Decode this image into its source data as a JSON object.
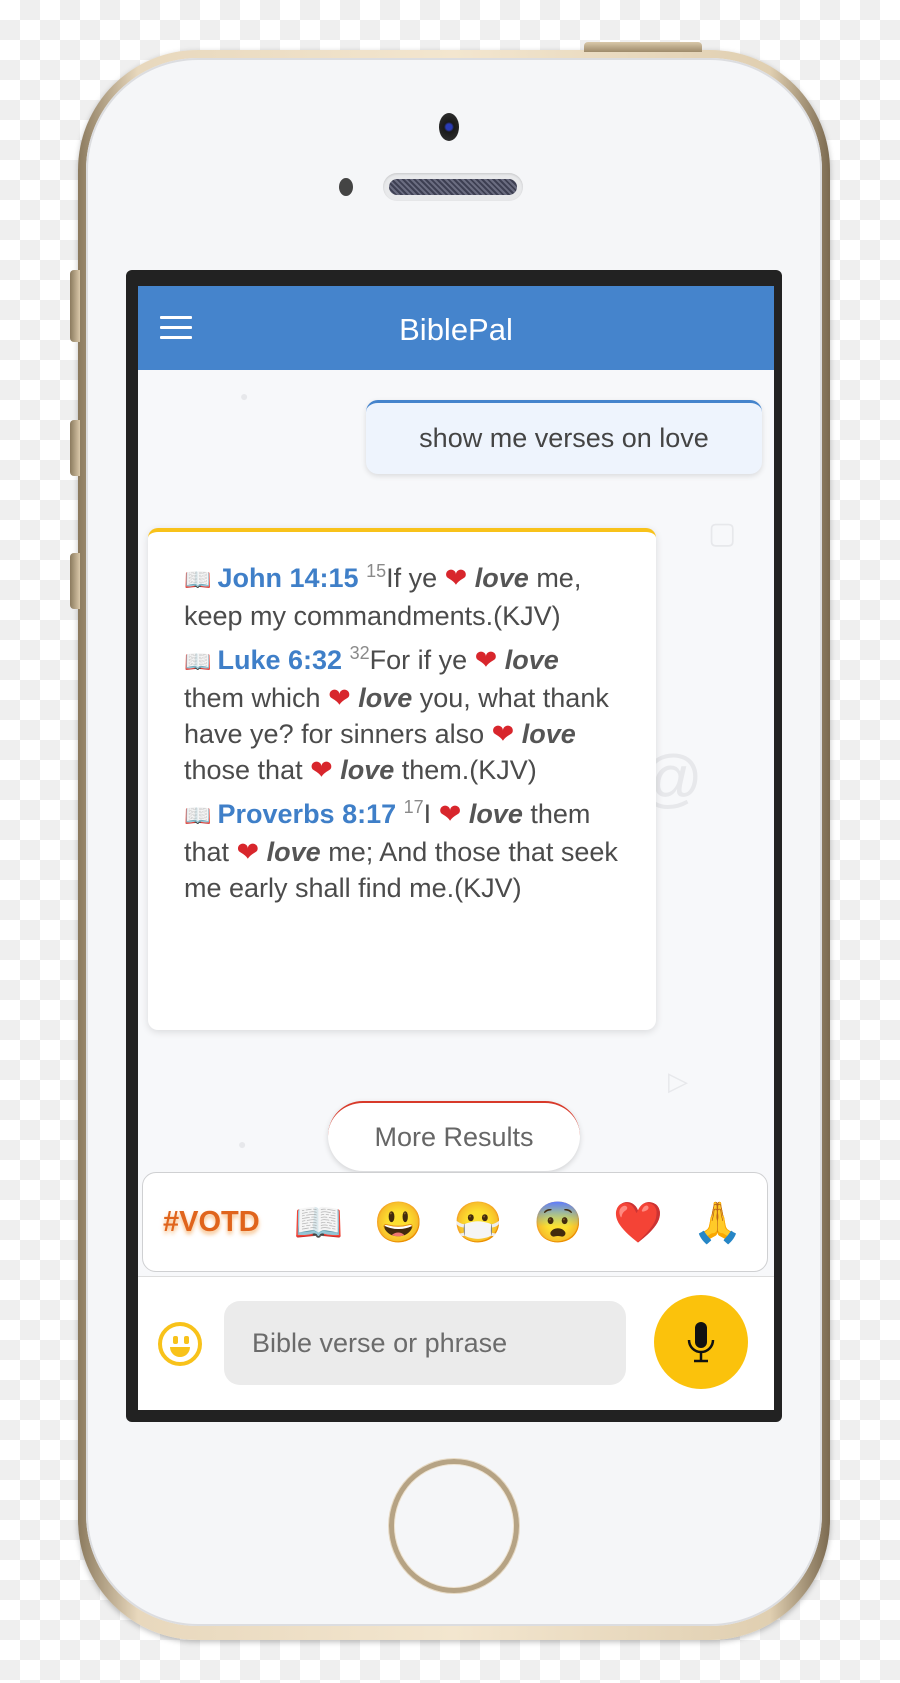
{
  "app": {
    "title": "BiblePal"
  },
  "conversation": {
    "user_message": "show me verses on love",
    "results": [
      {
        "reference": "John 14:15",
        "verse_number": "15",
        "segments": [
          {
            "t": "text",
            "v": "If ye "
          },
          {
            "t": "heart",
            "v": "❤"
          },
          {
            "t": "kw",
            "v": " love"
          },
          {
            "t": "text",
            "v": " me, keep my commandments.(KJV)"
          }
        ]
      },
      {
        "reference": "Luke 6:32",
        "verse_number": "32",
        "segments": [
          {
            "t": "text",
            "v": "For if ye "
          },
          {
            "t": "heart",
            "v": "❤"
          },
          {
            "t": "kw",
            "v": " love"
          },
          {
            "t": "text",
            "v": " them which "
          },
          {
            "t": "heart",
            "v": "❤"
          },
          {
            "t": "kw",
            "v": " love"
          },
          {
            "t": "text",
            "v": " you, what thank have ye? for sinners also "
          },
          {
            "t": "heart",
            "v": "❤"
          },
          {
            "t": "kw",
            "v": " love"
          },
          {
            "t": "text",
            "v": " those that "
          },
          {
            "t": "heart",
            "v": "❤"
          },
          {
            "t": "kw",
            "v": " love"
          },
          {
            "t": "text",
            "v": " them.(KJV)"
          }
        ]
      },
      {
        "reference": "Proverbs 8:17",
        "verse_number": "17",
        "segments": [
          {
            "t": "text",
            "v": "I "
          },
          {
            "t": "heart",
            "v": "❤"
          },
          {
            "t": "kw",
            "v": " love"
          },
          {
            "t": "text",
            "v": " them that "
          },
          {
            "t": "heart",
            "v": "❤"
          },
          {
            "t": "kw",
            "v": " love"
          },
          {
            "t": "text",
            "v": " me; And those that seek me early shall find me.(KJV)"
          }
        ]
      }
    ],
    "more_results_label": "More Results"
  },
  "quick_bar": {
    "votd_label": "#VOTD",
    "items": [
      {
        "name": "open-book-icon",
        "glyph": "📖"
      },
      {
        "name": "smiley-face-icon",
        "glyph": "😃"
      },
      {
        "name": "medical-mask-face-icon",
        "glyph": "😷"
      },
      {
        "name": "fearful-face-icon",
        "glyph": "😨"
      },
      {
        "name": "red-heart-icon",
        "glyph": "❤️"
      },
      {
        "name": "praying-hands-icon",
        "glyph": "🙏"
      }
    ]
  },
  "input": {
    "placeholder": "Bible verse or phrase",
    "value": ""
  },
  "colors": {
    "appbar": "#4584cc",
    "accent_yellow": "#fbc20c",
    "link_blue": "#3f7fc8",
    "votd_orange": "#e0641c"
  }
}
